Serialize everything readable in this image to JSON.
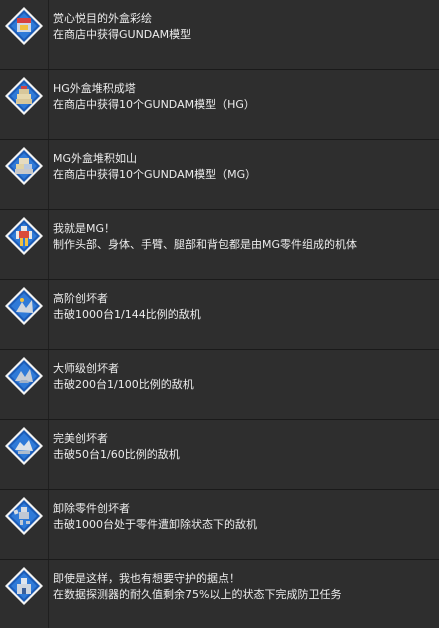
{
  "achievements": [
    {
      "title": "赏心悦目的外盒彩绘",
      "desc": "在商店中获得GUNDAM模型",
      "icon": "gunpla-box-badge-icon"
    },
    {
      "title": "HG外盒堆积成塔",
      "desc": "在商店中获得10个GUNDAM模型（HG）",
      "icon": "hg-box-stack-badge-icon"
    },
    {
      "title": "MG外盒堆积如山",
      "desc": "在商店中获得10个GUNDAM模型（MG）",
      "icon": "mg-box-mountain-badge-icon"
    },
    {
      "title": "我就是MG！",
      "desc": "制作头部、身体、手臂、腿部和背包都是由MG零件组成的机体",
      "icon": "mg-mobile-suit-badge-icon"
    },
    {
      "title": "高阶创坏者",
      "desc": "击破1000台1/144比例的敌机",
      "icon": "destroyer-144-badge-icon"
    },
    {
      "title": "大师级创坏者",
      "desc": "击破200台1/100比例的敌机",
      "icon": "destroyer-100-badge-icon"
    },
    {
      "title": "完美创坏者",
      "desc": "击破50台1/60比例的敌机",
      "icon": "destroyer-60-badge-icon"
    },
    {
      "title": "卸除零件创坏者",
      "desc": "击破1000台处于零件遭卸除状态下的敌机",
      "icon": "part-removal-badge-icon"
    },
    {
      "title": "即使是这样，我也有想要守护的据点！",
      "desc": "在数据探测器的耐久值剩余75%以上的状态下完成防卫任务",
      "icon": "defense-base-badge-icon"
    }
  ]
}
